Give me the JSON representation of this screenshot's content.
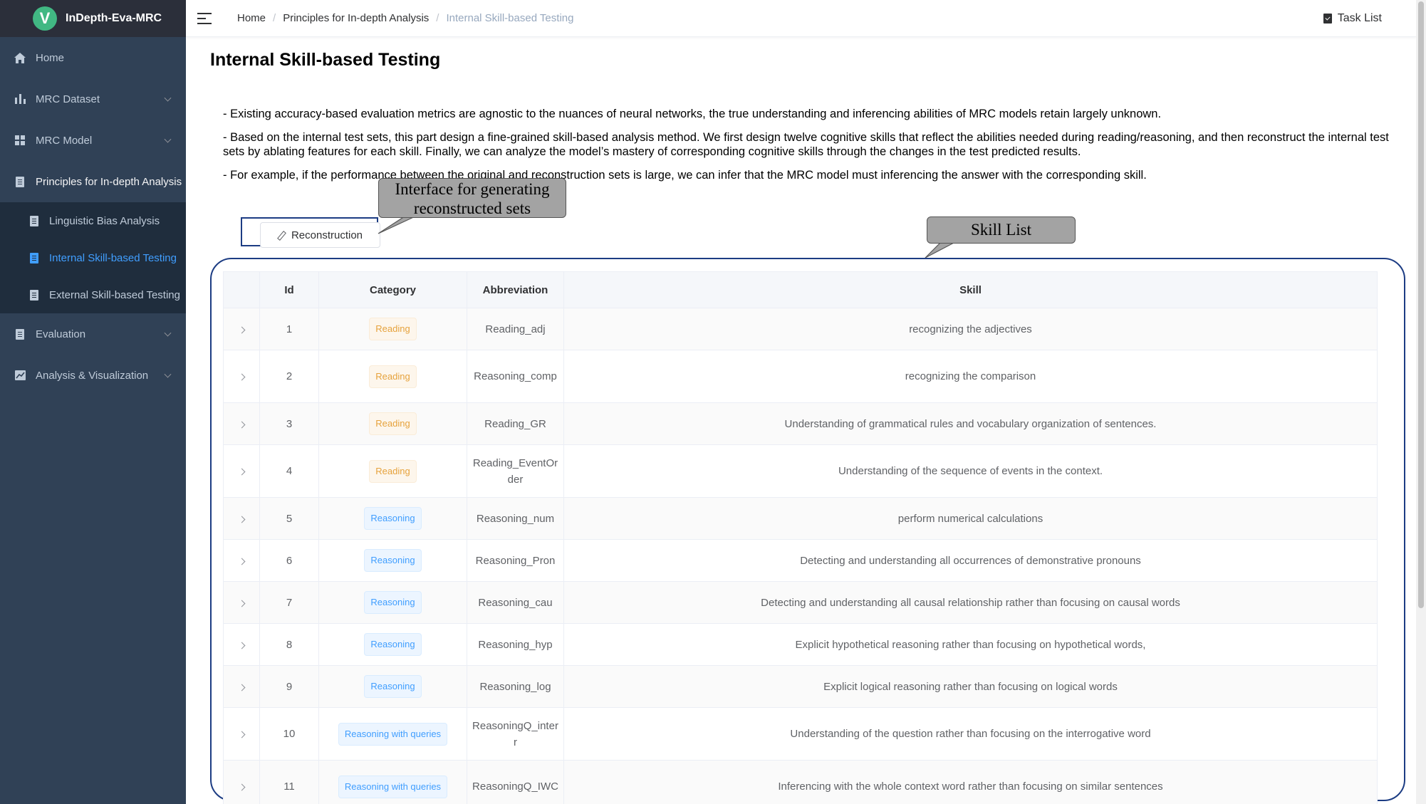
{
  "app": {
    "logo_letter": "V",
    "title": "InDepth-Eva-MRC"
  },
  "sidebar": {
    "items": [
      {
        "label": "Home",
        "icon": "home-icon",
        "arrow": false
      },
      {
        "label": "MRC Dataset",
        "icon": "bar-chart-icon",
        "arrow": true
      },
      {
        "label": "MRC Model",
        "icon": "grid-icon",
        "arrow": true
      },
      {
        "label": "Principles for In-depth Analysis",
        "icon": "document-icon",
        "arrow": false
      },
      {
        "label": "Evaluation",
        "icon": "document-icon",
        "arrow": true
      },
      {
        "label": "Analysis & Visualization",
        "icon": "line-chart-icon",
        "arrow": true
      }
    ],
    "subitems": [
      {
        "label": "Linguistic Bias Analysis",
        "icon": "document-icon"
      },
      {
        "label": "Internal Skill-based Testing",
        "icon": "document-icon",
        "active": true
      },
      {
        "label": "External Skill-based Testing",
        "icon": "document-icon"
      }
    ],
    "active_color": "#409eff"
  },
  "navbar": {
    "breadcrumb": [
      "Home",
      "Principles for In-depth Analysis",
      "Internal Skill-based Testing"
    ],
    "task_list": "Task List"
  },
  "main": {
    "title": "Internal Skill-based Testing",
    "paragraphs": [
      "- Existing accuracy-based evaluation metrics are agnostic to the nuances of neural networks, the true understanding and inferencing abilities of MRC models retain largely unknown.",
      "- Based on the internal test sets, this part design a fine-grained skill-based analysis method. We first design twelve cognitive skills that reflect the abilities needed during reading/reasoning, and then reconstruct the internal test sets by ablating features for each skill. Finally, we can analyze the model’s mastery of corresponding cognitive skills through the changes in the test predicted results.",
      "- For example, if the performance between the original and reconstruction sets is large, we can infer that the MRC model must inferencing the answer with the corresponding skill."
    ],
    "reconstruction_button": "Reconstruction",
    "callout_reconstruction": "Interface for generating reconstructed sets",
    "callout_skill_list": "Skill List"
  },
  "table": {
    "columns": [
      "",
      "Id",
      "Category",
      "Abbreviation",
      "Skill"
    ],
    "rows": [
      {
        "id": "1",
        "category": "Reading",
        "abbr": "Reading_adj",
        "skill": "recognizing the adjectives"
      },
      {
        "id": "2",
        "category": "Reading",
        "abbr": "Reasoning_comp",
        "skill": "recognizing the comparison"
      },
      {
        "id": "3",
        "category": "Reading",
        "abbr": "Reading_GR",
        "skill": "Understanding of grammatical rules and vocabulary organization of sentences."
      },
      {
        "id": "4",
        "category": "Reading",
        "abbr": "Reading_EventOrder",
        "skill": "Understanding of the sequence of events in the context."
      },
      {
        "id": "5",
        "category": "Reasoning",
        "abbr": "Reasoning_num",
        "skill": "perform numerical calculations"
      },
      {
        "id": "6",
        "category": "Reasoning",
        "abbr": "Reasoning_Pron",
        "skill": "Detecting and understanding all occurrences of demonstrative pronouns"
      },
      {
        "id": "7",
        "category": "Reasoning",
        "abbr": "Reasoning_cau",
        "skill": "Detecting and understanding all causal relationship rather than focusing on causal words"
      },
      {
        "id": "8",
        "category": "Reasoning",
        "abbr": "Reasoning_hyp",
        "skill": "Explicit hypothetical reasoning rather than focusing on hypothetical words,"
      },
      {
        "id": "9",
        "category": "Reasoning",
        "abbr": "Reasoning_log",
        "skill": "Explicit logical reasoning rather than focusing on logical words"
      },
      {
        "id": "10",
        "category": "Reasoning with queries",
        "abbr": "ReasoningQ_interr",
        "skill": "Understanding of the question rather than focusing on the interrogative word"
      },
      {
        "id": "11",
        "category": "Reasoning with queries",
        "abbr": "ReasoningQ_IWC",
        "skill": "Inferencing with the whole context word rather than focusing on similar sentences"
      }
    ]
  },
  "colors": {
    "sidebar_bg": "#304156",
    "reading_tag": "#e6a23c",
    "reasoning_tag": "#409eff",
    "annotation_border": "#1c3c83",
    "callout_fill": "#a3a3a3"
  }
}
